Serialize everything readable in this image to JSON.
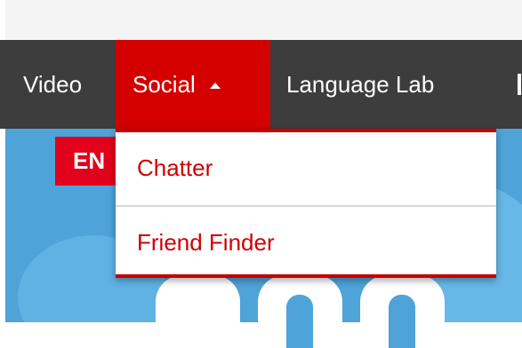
{
  "navbar": {
    "items": [
      {
        "label": "Video"
      },
      {
        "label": "Social",
        "active": true
      },
      {
        "label": "Language Lab"
      }
    ],
    "caret_icon": "caret-up-icon"
  },
  "dropdown": {
    "items": [
      {
        "label": "Chatter"
      },
      {
        "label": "Friend Finder"
      }
    ]
  },
  "hero": {
    "badge": "EN"
  },
  "colors": {
    "nav_bg": "#3d3d3d",
    "active_bg": "#d40000",
    "dropdown_text": "#cf0000",
    "hero_bg": "#4ea3d9"
  }
}
